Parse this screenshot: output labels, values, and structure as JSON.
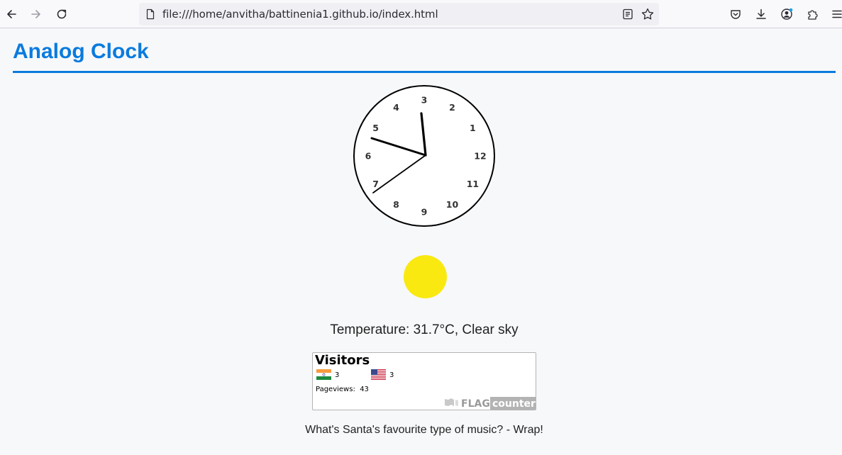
{
  "browser": {
    "url": "file:///home/anvitha/battinenia1.github.io/index.html"
  },
  "page": {
    "title": "Analog Clock"
  },
  "clock": {
    "numerals": [
      "12",
      "1",
      "2",
      "3",
      "4",
      "5",
      "6",
      "7",
      "8",
      "9",
      "10",
      "11"
    ]
  },
  "weather": {
    "text": "Temperature: 31.7°C, Clear sky",
    "icon_color": "#f9e910"
  },
  "flag_counter": {
    "title": "Visitors",
    "countries": [
      {
        "flag": "india-flag",
        "count": "3"
      },
      {
        "flag": "usa-flag",
        "count": "3"
      }
    ],
    "pageviews_label": "Pageviews:",
    "pageviews_value": "43",
    "logo_text_1": "FLAG",
    "logo_text_2": "counter"
  },
  "joke": {
    "text": "What's Santa's favourite type of music? - Wrap!"
  },
  "colors": {
    "accent": "#0a7bde"
  }
}
